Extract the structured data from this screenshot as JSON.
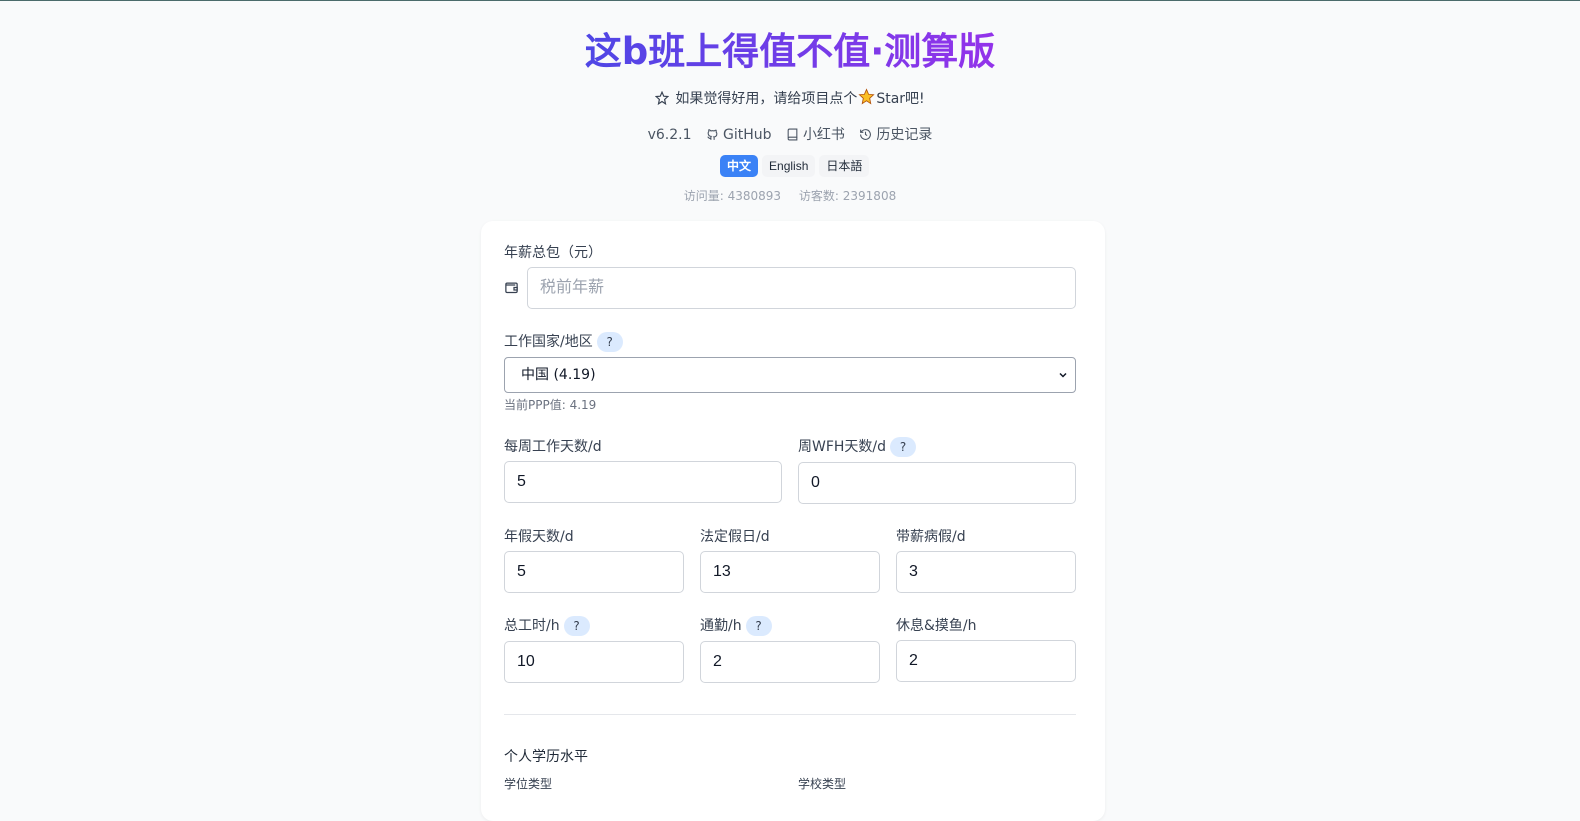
{
  "header": {
    "title": "这b班上得值不值·测算版",
    "star_prompt_before": "如果觉得好用，请给项目点个",
    "star_prompt_after": "Star吧!",
    "version": "v6.2.1",
    "links": [
      {
        "label": "GitHub",
        "icon": "github-icon"
      },
      {
        "label": "小红书",
        "icon": "book-icon"
      },
      {
        "label": "历史记录",
        "icon": "history-icon"
      }
    ],
    "languages": [
      {
        "label": "中文",
        "active": true
      },
      {
        "label": "English",
        "active": false
      },
      {
        "label": "日本語",
        "active": false
      }
    ],
    "stats": {
      "visits": "访问量: 4380893",
      "visitors": "访客数: 2391808"
    }
  },
  "form": {
    "salary": {
      "label": "年薪总包（元）",
      "placeholder": "税前年薪",
      "value": ""
    },
    "country": {
      "label": "工作国家/地区",
      "help": "?",
      "selected": "中国 (4.19)",
      "hint": "当前PPP值: 4.19"
    },
    "work_days": {
      "label": "每周工作天数/d",
      "value": "5"
    },
    "wfh_days": {
      "label": "周WFH天数/d",
      "help": "?",
      "value": "0"
    },
    "annual_leave": {
      "label": "年假天数/d",
      "value": "5"
    },
    "public_holidays": {
      "label": "法定假日/d",
      "value": "13"
    },
    "paid_sick_leave": {
      "label": "带薪病假/d",
      "value": "3"
    },
    "total_hours": {
      "label": "总工时/h",
      "help": "?",
      "value": "10"
    },
    "commute": {
      "label": "通勤/h",
      "help": "?",
      "value": "2"
    },
    "rest": {
      "label": "休息&摸鱼/h",
      "value": "2"
    },
    "education": {
      "section_title": "个人学历水平",
      "degree_label": "学位类型",
      "school_label": "学校类型"
    }
  },
  "colors": {
    "accent": "#3b82f6",
    "title_gradient_start": "#4f46e5",
    "title_gradient_end": "#9333ea",
    "help_badge": "#dbeafe"
  }
}
